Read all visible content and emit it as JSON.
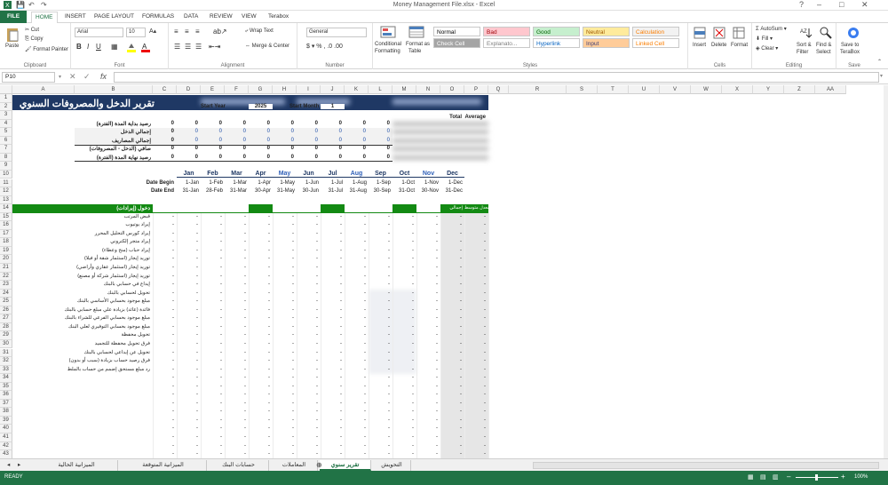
{
  "window": {
    "title": "Money Management File.xlsx - Excel"
  },
  "tabs": [
    "FILE",
    "HOME",
    "INSERT",
    "PAGE LAYOUT",
    "FORMULAS",
    "DATA",
    "REVIEW",
    "VIEW",
    "Terabox"
  ],
  "ribbon": {
    "clipboard": {
      "paste": "Paste",
      "cut": "Cut",
      "copy": "Copy",
      "painter": "Format Painter",
      "label": "Clipboard"
    },
    "font": {
      "name": "Arial",
      "size": "10",
      "label": "Font"
    },
    "alignment": {
      "wrap": "Wrap Text",
      "merge": "Merge & Center",
      "label": "Alignment"
    },
    "number": {
      "format": "General",
      "label": "Number"
    },
    "styles": {
      "cond": "Conditional",
      "cond2": "Formatting",
      "table": "Format as",
      "table2": "Table",
      "label": "Styles",
      "cells": [
        {
          "t": "Normal",
          "bg": "#ffffff",
          "fg": "#000000"
        },
        {
          "t": "Bad",
          "bg": "#ffc7ce",
          "fg": "#9c0006"
        },
        {
          "t": "Good",
          "bg": "#c6efce",
          "fg": "#006100"
        },
        {
          "t": "Neutral",
          "bg": "#ffeb9c",
          "fg": "#9c5700"
        },
        {
          "t": "Calculation",
          "bg": "#f2f2f2",
          "fg": "#fa7d00"
        },
        {
          "t": "Check Cell",
          "bg": "#a5a5a5",
          "fg": "#ffffff"
        },
        {
          "t": "Explanato...",
          "bg": "#ffffff",
          "fg": "#7f7f7f"
        },
        {
          "t": "Hyperlink",
          "bg": "#ffffff",
          "fg": "#0563c1"
        },
        {
          "t": "Input",
          "bg": "#ffcc99",
          "fg": "#3f3f76"
        },
        {
          "t": "Linked Cell",
          "bg": "#ffffff",
          "fg": "#fa7d00"
        }
      ]
    },
    "cells": {
      "insert": "Insert",
      "delete": "Delete",
      "format": "Format",
      "label": "Cells"
    },
    "editing": {
      "autosum": "AutoSum",
      "fill": "Fill",
      "clear": "Clear",
      "sort": "Sort &",
      "sort2": "Filter",
      "find": "Find &",
      "find2": "Select",
      "label": "Editing"
    },
    "save": {
      "b1": "Save to",
      "b2": "TeraBox",
      "label": "Save"
    }
  },
  "formula_bar": {
    "cell": "P10",
    "fx": "fx",
    "value": ""
  },
  "columns": [
    "A",
    "B",
    "C",
    "D",
    "E",
    "F",
    "G",
    "H",
    "I",
    "J",
    "K",
    "L",
    "M",
    "N",
    "O",
    "P",
    "Q",
    "R",
    "S",
    "T",
    "U",
    "V",
    "W",
    "X",
    "Y",
    "Z",
    "AA"
  ],
  "sheet": {
    "title": "تقرير الدخل والمصروفات السنوي",
    "start_year_label": "Start Year",
    "start_year": "2025",
    "start_month_label": "Start Month",
    "start_month": "1",
    "total": "Total",
    "average": "Average",
    "summary": [
      {
        "label": "رصيد بداية المدة (الفترة)",
        "v": "0"
      },
      {
        "label": "إجمالي الدخل",
        "v": "0"
      },
      {
        "label": "إجمالي المصاريف",
        "v": "0"
      },
      {
        "label": "صافي (الدخل - المصروفات)",
        "v": "0"
      },
      {
        "label": "رصيد نهاية المدة (الفترة)",
        "v": "0"
      }
    ],
    "months": [
      "Jan",
      "Feb",
      "Mar",
      "Apr",
      "May",
      "Jun",
      "Jul",
      "Aug",
      "Sep",
      "Oct",
      "Nov",
      "Dec"
    ],
    "date_begin_label": "Date Begin",
    "date_end_label": "Date End",
    "begin": [
      "1-Jan",
      "1-Feb",
      "1-Mar",
      "1-Apr",
      "1-May",
      "1-Jun",
      "1-Jul",
      "1-Aug",
      "1-Sep",
      "1-Oct",
      "1-Nov",
      "1-Dec"
    ],
    "end": [
      "31-Jan",
      "28-Feb",
      "31-Mar",
      "30-Apr",
      "31-May",
      "30-Jun",
      "31-Jul",
      "31-Aug",
      "30-Sep",
      "31-Oct",
      "30-Nov",
      "31-Dec"
    ],
    "income_header": "دخول (إيرادات)",
    "total_col": "إجمالي",
    "avg_col": "معدل متوسط",
    "income_items": [
      "قبض المرتب",
      "إيراد يوتيوب",
      "إيراد كورس التحليل المحرر",
      "إيراد متجر إلكتروني",
      "إيراد حباب (منح وعطاء)",
      "توريد إيجار (استثمار شقة أو فيلا)",
      "توريد إيجار (استثمار عقاري وأراضي)",
      "توريد إيجار (استثمار شركة أو مصنع)",
      "إيداع في حسابي بالبنك",
      "تحويل لحسابي بالبنك",
      "مبلغ موجود بحسابي الأساسي بالبنك",
      "فائدة (عائد) بزيادة علي مبلغ حسابي بالبنك",
      "مبلغ موجود بحسابي الفرعي للشراء بالبنك",
      "مبلغ موجود بحسابي التوفيري لعلي البنك",
      "تحويل محفظة",
      "فرق تحويل محفظة للتجميد",
      "تحويل عن إيداعي لحسابي بالبنك",
      "فرق رصيد حساب بزيادة (سبب أو بدون)",
      "رد مبلغ مستحق إضمم من حساب بالملط"
    ]
  },
  "sheet_tabs": [
    "الميزانية الحالية",
    "الميزانية المتوقعة",
    "حسابات البنك",
    "المعاملات",
    "تقرير سنوي",
    "التحويش"
  ],
  "active_sheet": "تقرير سنوي",
  "status": {
    "ready": "READY",
    "zoom": "100%"
  },
  "colors": {
    "excel_green": "#217346",
    "header_blue": "#1f3864",
    "band_green": "#138a13"
  }
}
